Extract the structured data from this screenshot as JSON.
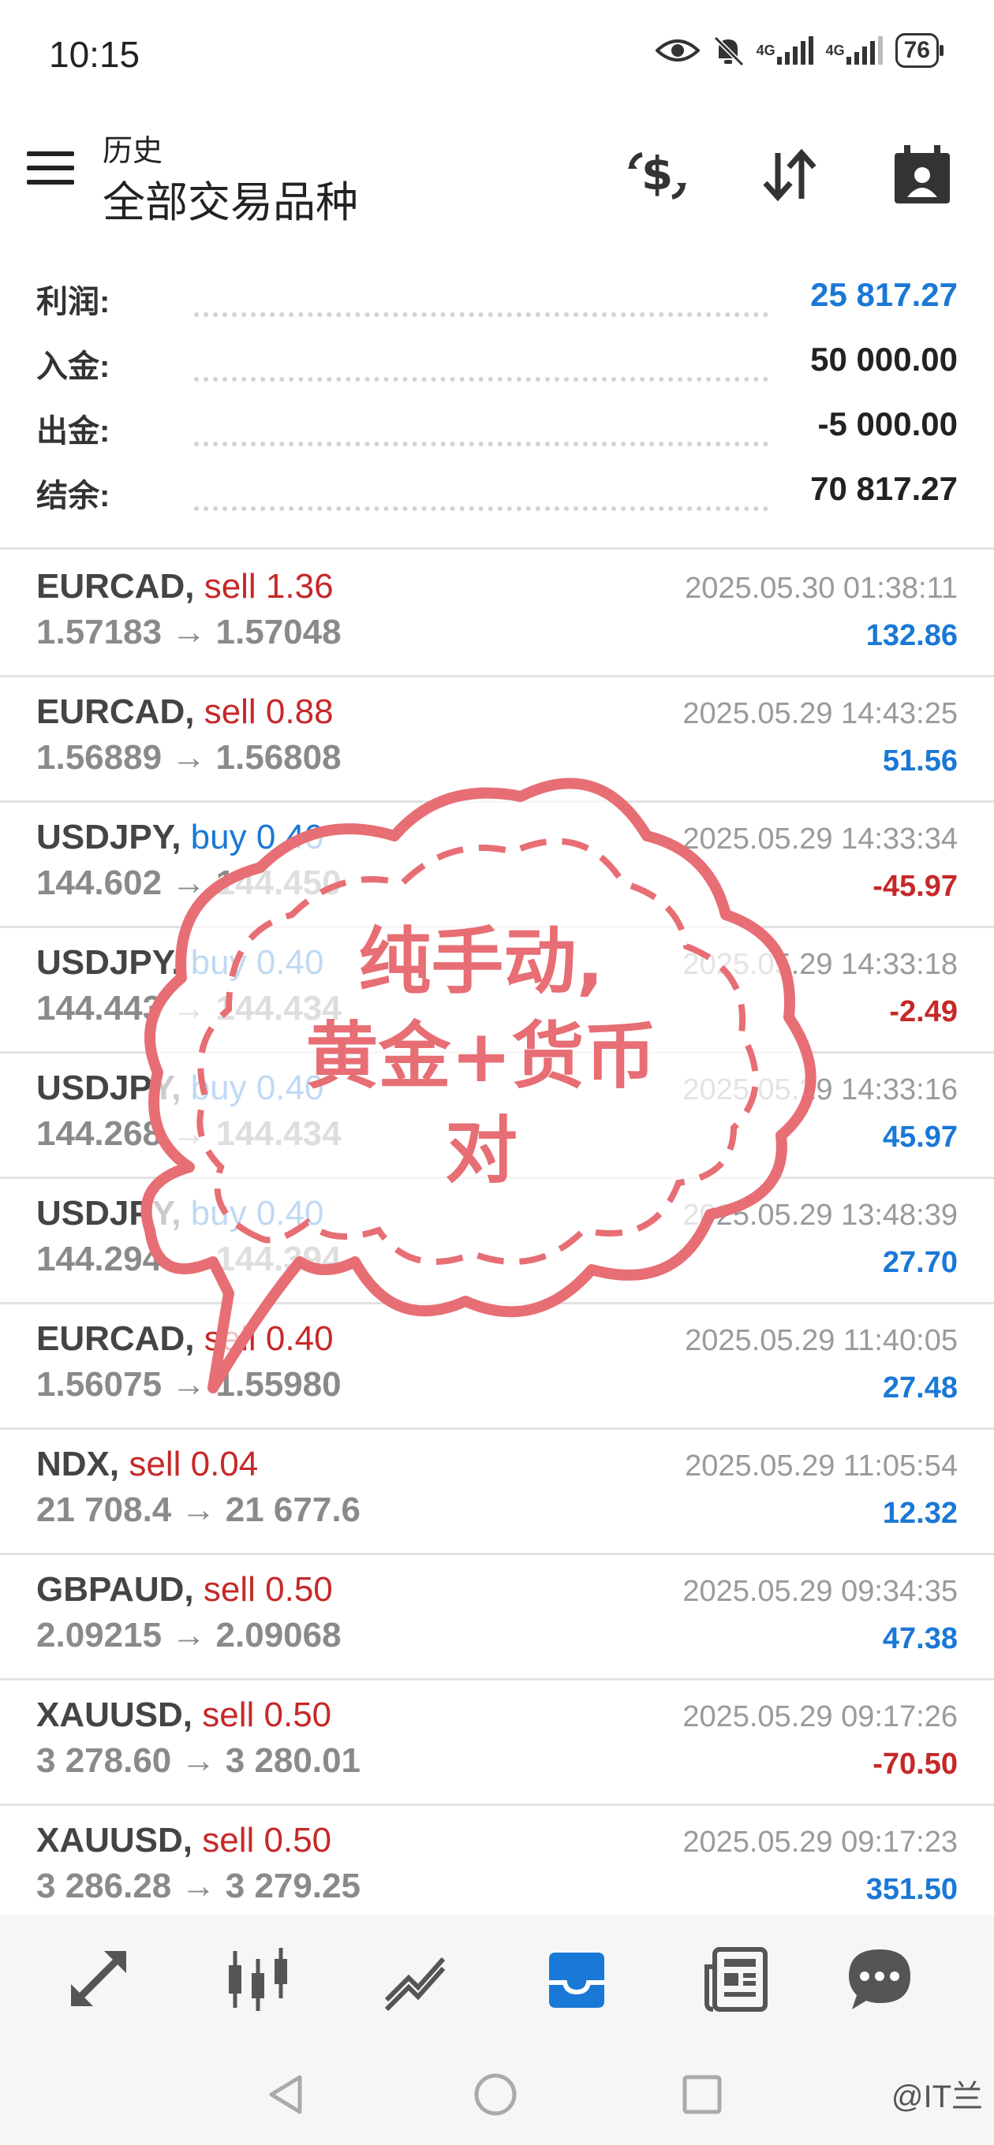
{
  "status": {
    "time": "10:15",
    "battery": "76",
    "signal1": "4G",
    "signal2": "4G"
  },
  "header": {
    "subtitle": "历史",
    "title": "全部交易品种"
  },
  "summary": [
    {
      "label": "利润:",
      "value": "25 817.27",
      "accent": "blue"
    },
    {
      "label": "入金:",
      "value": "50 000.00",
      "accent": "dark"
    },
    {
      "label": "出金:",
      "value": "-5 000.00",
      "accent": "dark"
    },
    {
      "label": "结余:",
      "value": "70 817.27",
      "accent": "dark"
    }
  ],
  "trades": [
    {
      "symbol": "EURCAD,",
      "side": "sell",
      "side_label": "sell 1.36",
      "open": "1.57183",
      "close": "1.57048",
      "time": "2025.05.30 01:38:11",
      "profit": "132.86"
    },
    {
      "symbol": "EURCAD,",
      "side": "sell",
      "side_label": "sell 0.88",
      "open": "1.56889",
      "close": "1.56808",
      "time": "2025.05.29 14:43:25",
      "profit": "51.56"
    },
    {
      "symbol": "USDJPY,",
      "side": "buy",
      "side_label": "buy 0.40",
      "open": "144.602",
      "close": "144.450",
      "time": "2025.05.29 14:33:34",
      "profit": "-45.97"
    },
    {
      "symbol": "USDJPY,",
      "side": "buy",
      "side_label": "buy 0.40",
      "open": "144.443",
      "close": "144.434",
      "time": "2025.05.29 14:33:18",
      "profit": "-2.49"
    },
    {
      "symbol": "USDJPY,",
      "side": "buy",
      "side_label": "buy 0.40",
      "open": "144.268",
      "close": "144.434",
      "time": "2025.05.29 14:33:16",
      "profit": "45.97"
    },
    {
      "symbol": "USDJPY,",
      "side": "buy",
      "side_label": "buy 0.40",
      "open": "144.294",
      "close": "144.394",
      "time": "2025.05.29 13:48:39",
      "profit": "27.70"
    },
    {
      "symbol": "EURCAD,",
      "side": "sell",
      "side_label": "sell 0.40",
      "open": "1.56075",
      "close": "1.55980",
      "time": "2025.05.29 11:40:05",
      "profit": "27.48"
    },
    {
      "symbol": "NDX,",
      "side": "sell",
      "side_label": "sell 0.04",
      "open": "21 708.4",
      "close": "21 677.6",
      "time": "2025.05.29 11:05:54",
      "profit": "12.32"
    },
    {
      "symbol": "GBPAUD,",
      "side": "sell",
      "side_label": "sell 0.50",
      "open": "2.09215",
      "close": "2.09068",
      "time": "2025.05.29 09:34:35",
      "profit": "47.38"
    },
    {
      "symbol": "XAUUSD,",
      "side": "sell",
      "side_label": "sell 0.50",
      "open": "3 278.60",
      "close": "3 280.01",
      "time": "2025.05.29 09:17:26",
      "profit": "-70.50"
    },
    {
      "symbol": "XAUUSD,",
      "side": "sell",
      "side_label": "sell 0.50",
      "open": "3 286.28",
      "close": "3 279.25",
      "time": "2025.05.29 09:17:23",
      "profit": "351.50"
    }
  ],
  "arrow": "→",
  "sticker": {
    "line1": "纯手动,",
    "line2": "黄金+货币",
    "line3": "对",
    "color": "#e76e74"
  },
  "nav": [
    "quotes-icon",
    "chart-icon",
    "trade-icon",
    "history-icon",
    "news-icon",
    "chat-icon"
  ],
  "watermark": "@IT兰",
  "colors": {
    "blue": "#1a78d6",
    "red": "#c62828",
    "active_nav": "#1a78d6"
  }
}
